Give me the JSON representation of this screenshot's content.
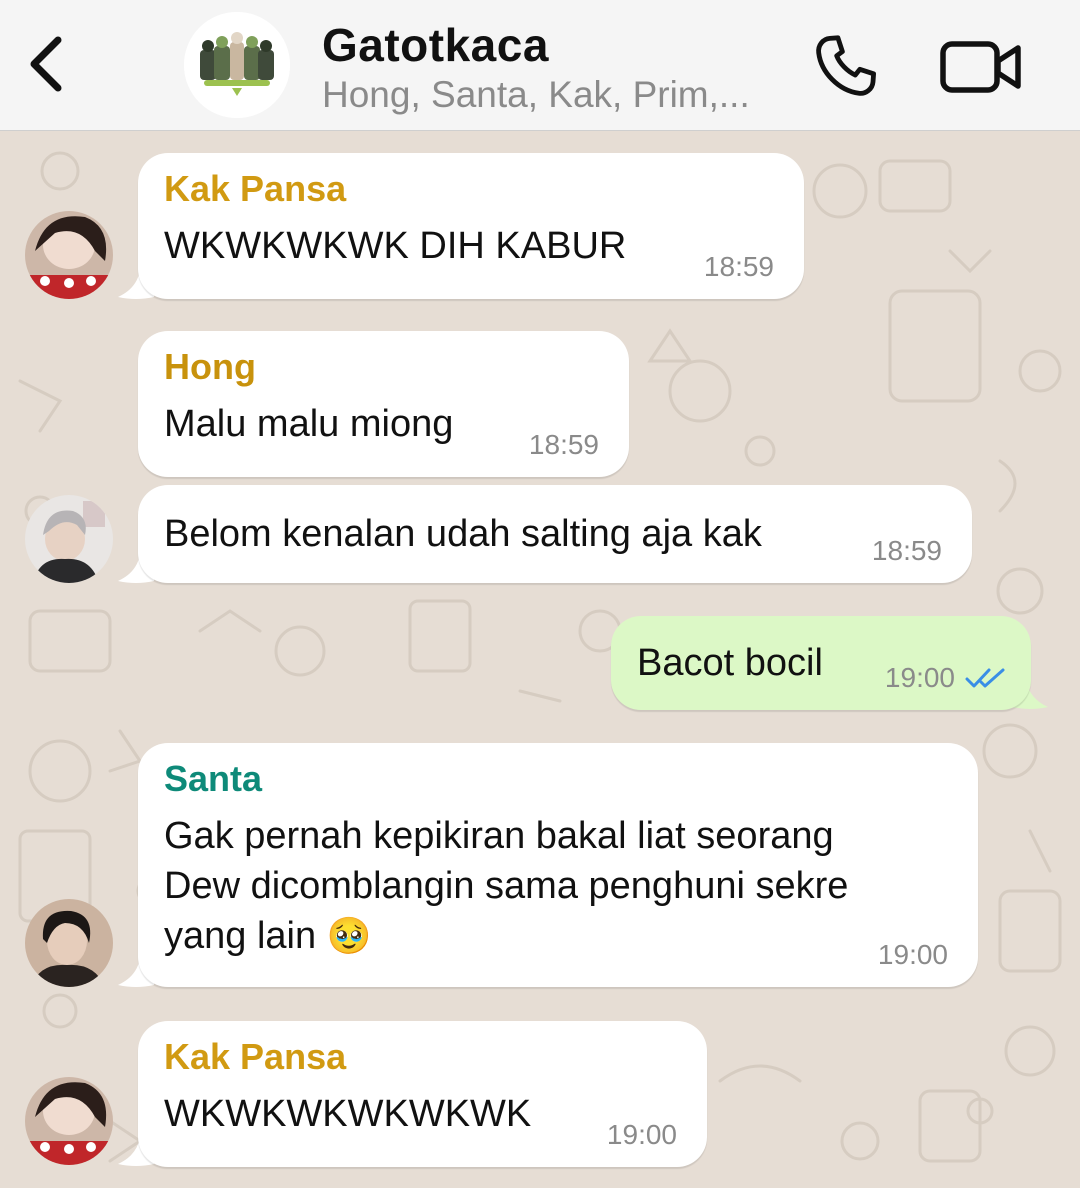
{
  "header": {
    "back_icon": "chevron-left-icon",
    "title": "Gatotkaca",
    "subtitle": "Hong, Santa, Kak, Prim,...",
    "call_icon": "phone-icon",
    "video_icon": "video-camera-icon"
  },
  "messages": [
    {
      "sender": "Kak Pansa",
      "sender_color": "#d19a12",
      "text": "WKWKWKWK DIH KABUR",
      "time": "18:59",
      "direction": "in"
    },
    {
      "sender": "Hong",
      "sender_color": "#c8920c",
      "text": "Malu malu miong",
      "time": "18:59",
      "direction": "in"
    },
    {
      "text": "Belom kenalan udah salting aja kak",
      "time": "18:59",
      "direction": "in"
    },
    {
      "text": "Bacot bocil",
      "time": "19:00",
      "direction": "out",
      "status": "read",
      "status_icon": "double-check-icon"
    },
    {
      "sender": "Santa",
      "sender_color": "#0e8a79",
      "text_lines": [
        "Gak pernah kepikiran bakal liat seorang",
        "Dew dicomblangin sama penghuni sekre",
        "yang lain"
      ],
      "emoji": "🥹",
      "time": "19:00",
      "direction": "in"
    },
    {
      "sender": "Kak Pansa",
      "sender_color": "#d19a12",
      "text": "WKWKWKWKWKWK",
      "time": "19:00",
      "direction": "in"
    }
  ],
  "colors": {
    "incoming_bubble": "#ffffff",
    "outgoing_bubble": "#dcf8c6",
    "read_ticks": "#3a8ee6",
    "chat_background": "#e6ddd4"
  }
}
